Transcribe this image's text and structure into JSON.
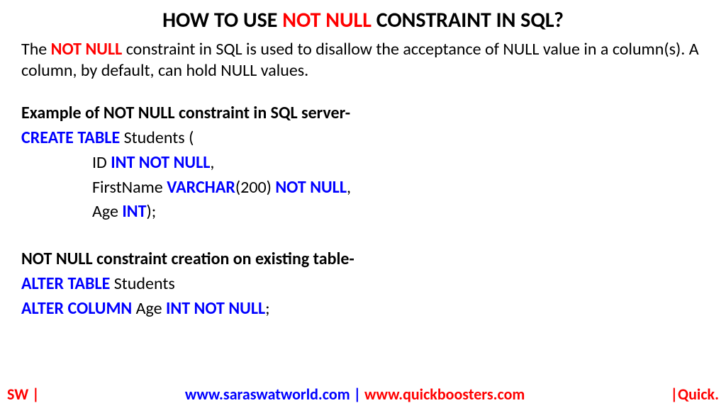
{
  "title": {
    "pre": "HOW TO USE ",
    "highlight": "NOT NULL",
    "post": " CONSTRAINT IN SQL?"
  },
  "description": {
    "pre": "The ",
    "highlight": "NOT NULL",
    "post": " constraint in SQL is used to disallow the acceptance of NULL value in a column(s). A column, by default, can hold NULL values."
  },
  "example1": {
    "header": "Example of NOT NULL constraint in SQL server-",
    "line1_kw": "CREATE TABLE",
    "line1_rest": " Students (",
    "line2_col": "ID ",
    "line2_kw": "INT NOT NULL",
    "line2_rest": ",",
    "line3_col": "FirstName ",
    "line3_kw1": "VARCHAR",
    "line3_mid": "(200) ",
    "line3_kw2": "NOT NULL",
    "line3_rest": ",",
    "line4_col": "Age ",
    "line4_kw": "INT",
    "line4_rest": ");"
  },
  "example2": {
    "header": "NOT NULL constraint creation on existing table-",
    "line1_kw": "ALTER TABLE",
    "line1_rest": " Students",
    "line2_kw": "ALTER COLUMN",
    "line2_mid": " Age ",
    "line2_kw2": "INT NOT NULL",
    "line2_rest": ";"
  },
  "footer": {
    "left": "SW |",
    "center_blue": "www.saraswatworld.com | ",
    "center_red": "www.quickboosters.com",
    "right": "|Quick."
  }
}
